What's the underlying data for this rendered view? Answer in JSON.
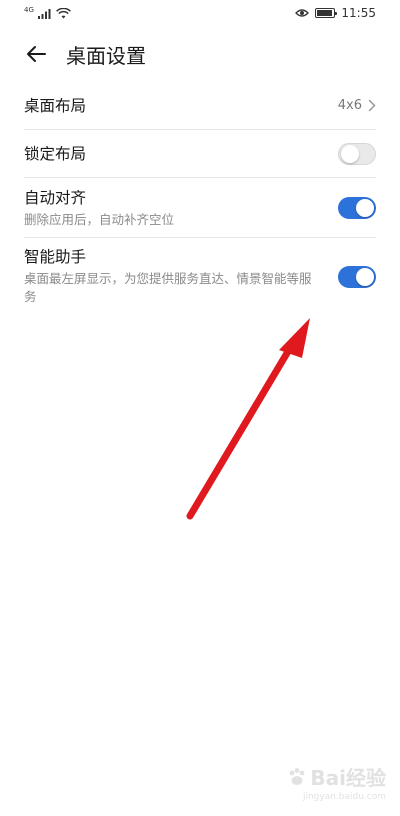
{
  "status_bar": {
    "network_tag": "4G",
    "time": "11:55",
    "battery_level": 0.9
  },
  "header": {
    "back_icon": "arrow-left-icon",
    "title": "桌面设置"
  },
  "settings": [
    {
      "id": "layout",
      "title": "桌面布局",
      "value": "4x6",
      "control": "chevron"
    },
    {
      "id": "lock-layout",
      "title": "锁定布局",
      "control": "toggle",
      "checked": false
    },
    {
      "id": "auto-align",
      "title": "自动对齐",
      "subtitle": "删除应用后，自动补齐空位",
      "control": "toggle",
      "checked": true
    },
    {
      "id": "smart-assistant",
      "title": "智能助手",
      "subtitle": "桌面最左屏显示，为您提供服务直达、情景智能等服务",
      "control": "toggle",
      "checked": true
    }
  ],
  "colors": {
    "toggle_on": "#2d72d9",
    "toggle_off": "#e9e9e9",
    "annotation_arrow": "#e0191e"
  },
  "watermark": {
    "logo_text": "Bai经验",
    "url": "jingyan.baidu.com"
  }
}
